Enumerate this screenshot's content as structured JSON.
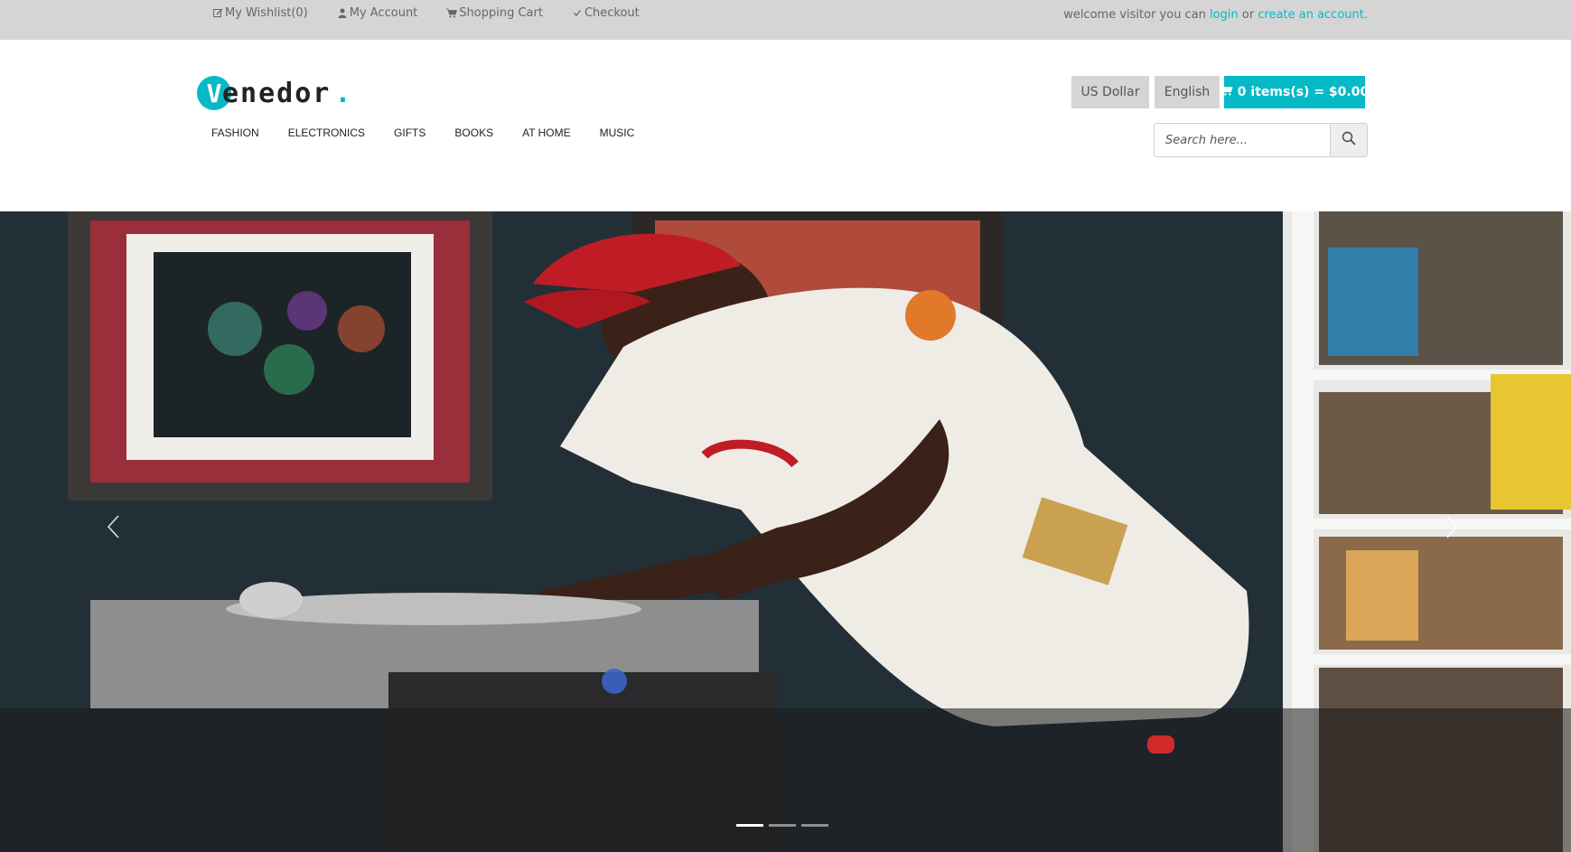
{
  "topbar": {
    "links": [
      {
        "label": "My Wishlist(0)",
        "icon": "edit-icon"
      },
      {
        "label": "My Account",
        "icon": "user-icon"
      },
      {
        "label": "Shopping Cart",
        "icon": "cart-icon"
      },
      {
        "label": "Checkout",
        "icon": "check-icon"
      }
    ],
    "welcome_prefix": "welcome visitor you can",
    "login_label": "login",
    "or_text": "or",
    "create_account_label": "create an account."
  },
  "header": {
    "logo_first_letter": "V",
    "logo_rest": "enedor",
    "logo_dot": ".",
    "currency_label": "US Dollar",
    "language_label": "English",
    "cart_label": "0 items(s) = $0.00",
    "search_placeholder": "Search here...",
    "search_value": ""
  },
  "nav": {
    "items": [
      "FASHION",
      "ELECTRONICS",
      "GIFTS",
      "BOOKS",
      "AT HOME",
      "MUSIC"
    ]
  },
  "slider": {
    "slide_count": 3,
    "active_index": 0,
    "prev_icon": "chevron-left-icon",
    "next_icon": "chevron-right-icon"
  },
  "colors": {
    "accent": "#06b9c6",
    "topbar_bg": "#d5d5d5",
    "button_grey": "#d5d5d5"
  }
}
